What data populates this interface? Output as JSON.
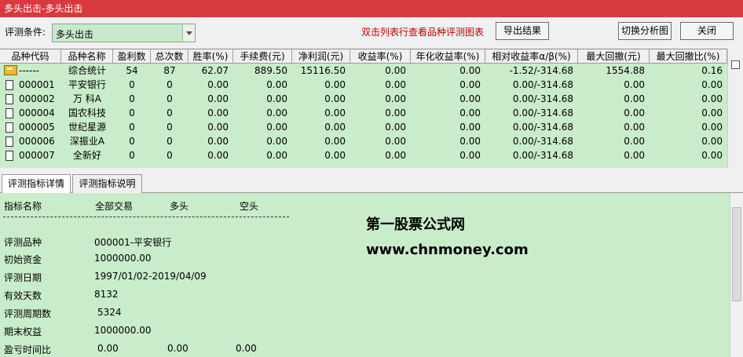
{
  "window": {
    "title": "多头出击-多头出击"
  },
  "toolbar": {
    "condition_label": "评测条件:",
    "condition_value": "多头出击",
    "hint": "双击列表行查看品种评测图表",
    "export_label": "导出结果",
    "switch_label": "切换分析图",
    "close_label": "关闭"
  },
  "grid": {
    "columns": [
      "品种代码",
      "品种名称",
      "盈利数",
      "总次数",
      "胜率(%)",
      "手续费(元)",
      "净利润(元)",
      "收益率(%)",
      "年化收益率(%)",
      "相对收益率α/β(%)",
      "最大回撤(元)",
      "最大回撤比(%)"
    ],
    "rows": [
      {
        "icon": "folder-icon",
        "cells": [
          "------",
          "综合统计",
          "54",
          "87",
          "62.07",
          "889.50",
          "15116.50",
          "0.00",
          "0.00",
          "-1.52/-314.68",
          "1554.88",
          "0.16"
        ]
      },
      {
        "icon": "document-icon",
        "cells": [
          "000001",
          "平安银行",
          "0",
          "0",
          "0.00",
          "0.00",
          "0.00",
          "0.00",
          "0.00",
          "0.00/-314.68",
          "0.00",
          "0.00"
        ]
      },
      {
        "icon": "document-icon",
        "cells": [
          "000002",
          "万 科A",
          "0",
          "0",
          "0.00",
          "0.00",
          "0.00",
          "0.00",
          "0.00",
          "0.00/-314.68",
          "0.00",
          "0.00"
        ]
      },
      {
        "icon": "document-icon",
        "cells": [
          "000004",
          "国农科技",
          "0",
          "0",
          "0.00",
          "0.00",
          "0.00",
          "0.00",
          "0.00",
          "0.00/-314.68",
          "0.00",
          "0.00"
        ]
      },
      {
        "icon": "document-icon",
        "cells": [
          "000005",
          "世纪星源",
          "0",
          "0",
          "0.00",
          "0.00",
          "0.00",
          "0.00",
          "0.00",
          "0.00/-314.68",
          "0.00",
          "0.00"
        ]
      },
      {
        "icon": "document-icon",
        "cells": [
          "000006",
          "深振业A",
          "0",
          "0",
          "0.00",
          "0.00",
          "0.00",
          "0.00",
          "0.00",
          "0.00/-314.68",
          "0.00",
          "0.00"
        ]
      },
      {
        "icon": "document-icon",
        "cells": [
          "000007",
          "全新好",
          "0",
          "0",
          "0.00",
          "0.00",
          "0.00",
          "0.00",
          "0.00",
          "0.00/-314.68",
          "0.00",
          "0.00"
        ]
      }
    ]
  },
  "tabs": [
    "评测指标详情",
    "评测指标说明"
  ],
  "detail": {
    "headers": [
      "指标名称",
      "全部交易",
      "多头",
      "空头"
    ],
    "items": [
      {
        "label": "评测品种",
        "value": "000001-平安银行"
      },
      {
        "label": "初始资金",
        "value": "1000000.00"
      },
      {
        "label": "评测日期",
        "value": "1997/01/02-2019/04/09"
      },
      {
        "label": "有效天数",
        "value": "8132"
      },
      {
        "label": "评测周期数",
        "value": "5324"
      },
      {
        "label": "期末权益",
        "value": "1000000.00"
      },
      {
        "label": "盈亏时间比",
        "value": "0.00",
        "long": "0.00",
        "short": "0.00"
      }
    ],
    "watermark_name": "第一股票公式网",
    "watermark_url": "www.chnmoney.com"
  }
}
